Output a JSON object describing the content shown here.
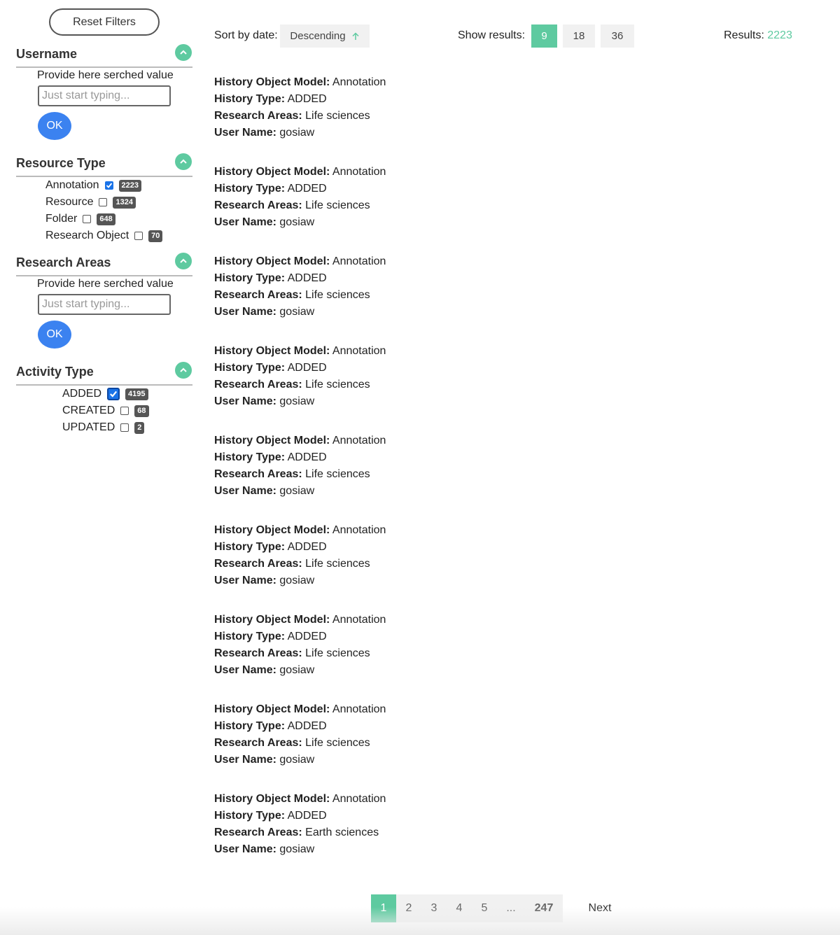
{
  "sidebar": {
    "reset_label": "Reset Filters",
    "username": {
      "title": "Username",
      "field_label": "Provide here serched value",
      "placeholder": "Just start typing...",
      "ok_label": "OK"
    },
    "resource_type": {
      "title": "Resource Type",
      "items": [
        {
          "label": "Annotation",
          "checked": true,
          "count": "2223"
        },
        {
          "label": "Resource",
          "checked": false,
          "count": "1324"
        },
        {
          "label": "Folder",
          "checked": false,
          "count": "648"
        },
        {
          "label": "Research Object",
          "checked": false,
          "count": "70"
        }
      ]
    },
    "research_areas": {
      "title": "Research Areas",
      "field_label": "Provide here serched value",
      "placeholder": "Just start typing...",
      "ok_label": "OK"
    },
    "activity_type": {
      "title": "Activity Type",
      "items": [
        {
          "label": "ADDED",
          "checked": true,
          "count": "4195"
        },
        {
          "label": "CREATED",
          "checked": false,
          "count": "68"
        },
        {
          "label": "UPDATED",
          "checked": false,
          "count": "2"
        }
      ]
    }
  },
  "topbar": {
    "sort_label": "Sort by date:",
    "sort_value": "Descending",
    "show_label": "Show results:",
    "page_sizes": [
      "9",
      "18",
      "36"
    ],
    "results_label": "Results:",
    "results_count": "2223"
  },
  "field_labels": {
    "model": "History Object Model:",
    "type": "History Type:",
    "areas": "Research Areas:",
    "user": "User Name:"
  },
  "results": [
    {
      "model": "Annotation",
      "type": "ADDED",
      "areas": "Life sciences",
      "user": "gosiaw"
    },
    {
      "model": "Annotation",
      "type": "ADDED",
      "areas": "Life sciences",
      "user": "gosiaw"
    },
    {
      "model": "Annotation",
      "type": "ADDED",
      "areas": "Life sciences",
      "user": "gosiaw"
    },
    {
      "model": "Annotation",
      "type": "ADDED",
      "areas": "Life sciences",
      "user": "gosiaw"
    },
    {
      "model": "Annotation",
      "type": "ADDED",
      "areas": "Life sciences",
      "user": "gosiaw"
    },
    {
      "model": "Annotation",
      "type": "ADDED",
      "areas": "Life sciences",
      "user": "gosiaw"
    },
    {
      "model": "Annotation",
      "type": "ADDED",
      "areas": "Life sciences",
      "user": "gosiaw"
    },
    {
      "model": "Annotation",
      "type": "ADDED",
      "areas": "Life sciences",
      "user": "gosiaw"
    },
    {
      "model": "Annotation",
      "type": "ADDED",
      "areas": "Earth sciences",
      "user": "gosiaw"
    }
  ],
  "pagination": {
    "pages": [
      "1",
      "2",
      "3",
      "4",
      "5"
    ],
    "ellipsis": "...",
    "last": "247",
    "next_label": "Next"
  },
  "colors": {
    "accent": "#5ecaa0",
    "primary_button": "#3b82f0",
    "checkbox_checked": "#1a73e8",
    "badge": "#555555"
  },
  "icons": {
    "collapse": "chevron-up-icon",
    "sort": "arrow-up-icon",
    "checkbox": "checkmark-icon"
  }
}
